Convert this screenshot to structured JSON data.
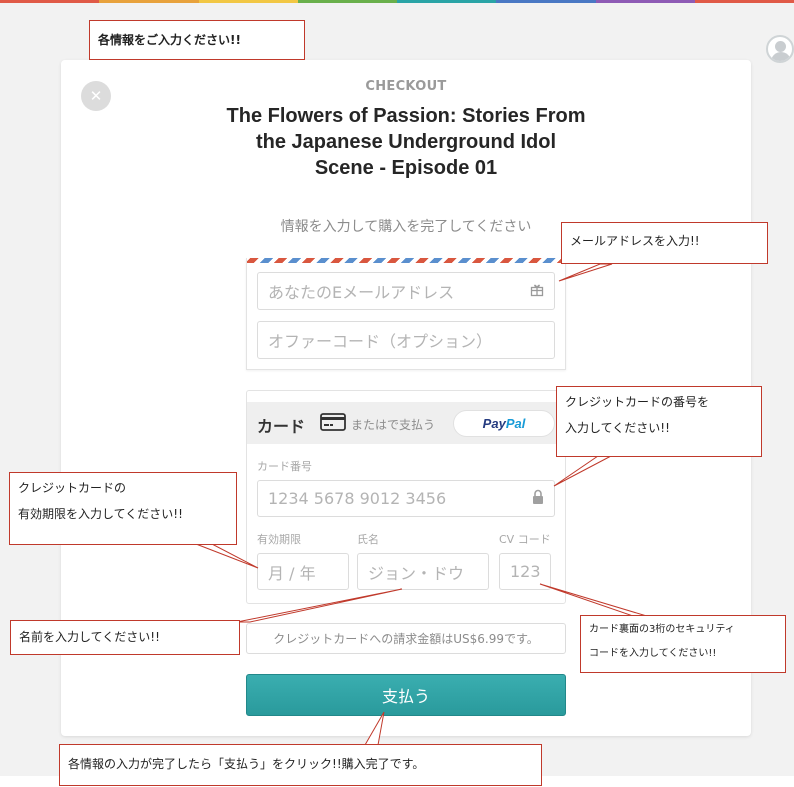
{
  "colors": {
    "accent": "#2aa4a6",
    "annotation_border": "#c0392b",
    "top_strip": [
      "#e05a47",
      "#e8a23c",
      "#f2c744",
      "#6ab04c",
      "#2aa4a6",
      "#4a78c4",
      "#8e5bb5",
      "#e05a47"
    ]
  },
  "checkout": {
    "label": "CHECKOUT",
    "title": "The Flowers of Passion: Stories From the Japanese Underground Idol Scene - Episode 01",
    "subtitle": "情報を入力して購入を完了してください",
    "close_icon": "close-icon"
  },
  "contact": {
    "email_placeholder": "あなたのEメールアドレス",
    "offer_placeholder": "オファーコード（オプション）"
  },
  "payment": {
    "card_label": "カード",
    "or_pay_with": "またはで支払う",
    "paypal_part1": "Pay",
    "paypal_part2": "Pal",
    "card_number_label": "カード番号",
    "card_number_placeholder": "1234 5678 9012 3456",
    "expiry_label": "有効期限",
    "expiry_placeholder": "月 / 年",
    "name_label": "氏名",
    "name_placeholder": "ジョン・ドウ",
    "cvc_label": "CV コード",
    "cvc_placeholder": "123"
  },
  "charge_notice": "クレジットカードへの請求金額はUS$6.99です。",
  "pay_button": "支払う",
  "annotations": {
    "top": "各情報をご入力ください!!",
    "email": "メールアドレスを入力!!",
    "card_number": [
      "クレジットカードの番号を",
      "入力してください!!"
    ],
    "expiry": [
      "クレジットカードの",
      "有効期限を入力してください!!"
    ],
    "name": "名前を入力してください!!",
    "cvc": [
      "カード裏面の3桁のセキュリティ",
      "コードを入力してください!!"
    ],
    "pay": "各情報の入力が完了したら「支払う」をクリック!!購入完了です。"
  }
}
